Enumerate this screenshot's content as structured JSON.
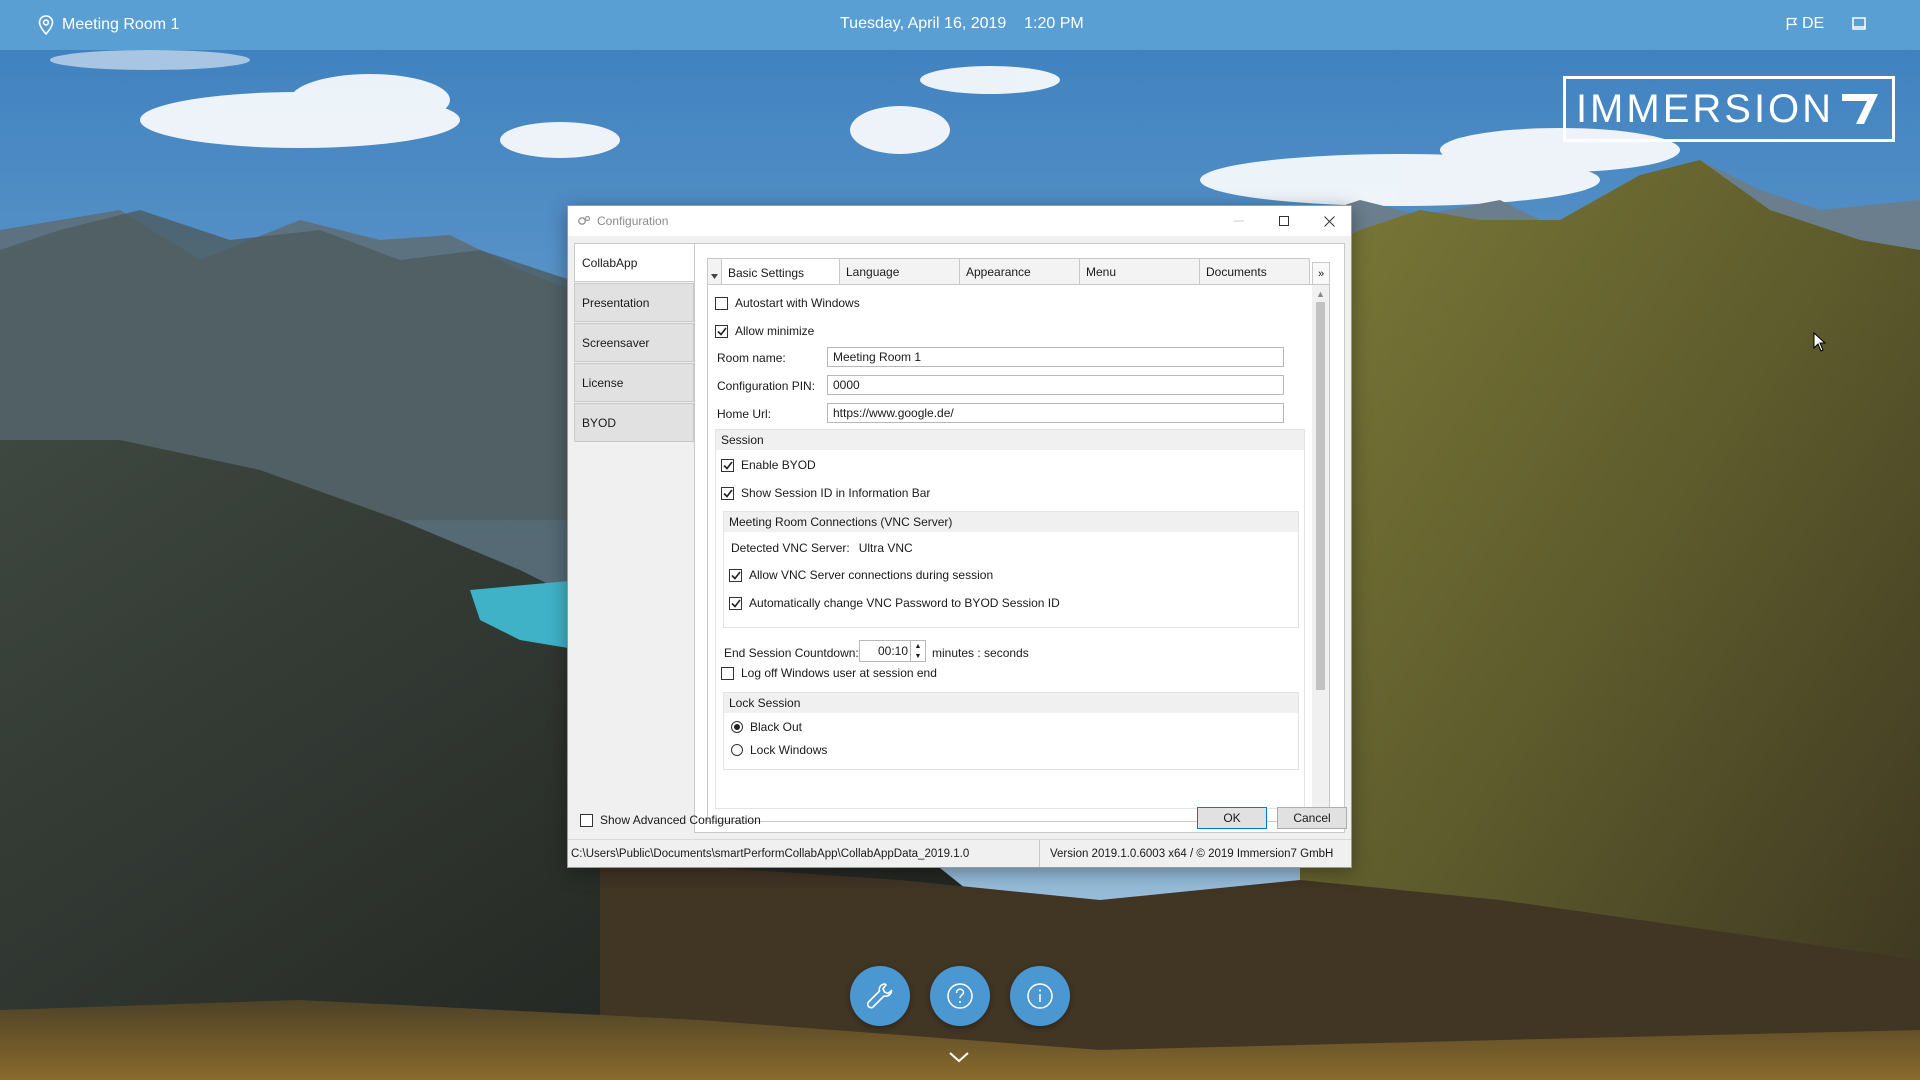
{
  "topbar": {
    "room": "Meeting Room 1",
    "date": "Tuesday, April 16, 2019",
    "time": "1:20 PM",
    "language": "DE",
    "location_icon": "location-pin-icon",
    "flag_icon": "flag-icon",
    "screen_icon": "screen-icon"
  },
  "logo": {
    "text": "IMMERSION",
    "mark": "7"
  },
  "dialog": {
    "title": "Configuration",
    "side_tabs": [
      {
        "label": "CollabApp",
        "active": true
      },
      {
        "label": "Presentation",
        "active": false
      },
      {
        "label": "Screensaver",
        "active": false
      },
      {
        "label": "License",
        "active": false
      },
      {
        "label": "BYOD",
        "active": false
      }
    ],
    "tabs": [
      {
        "label": "Basic Settings",
        "active": true
      },
      {
        "label": "Language",
        "active": false
      },
      {
        "label": "Appearance",
        "active": false
      },
      {
        "label": "Menu",
        "active": false
      },
      {
        "label": "Documents",
        "active": false
      }
    ],
    "tab_more": "»",
    "basic": {
      "autostart": {
        "label": "Autostart with Windows",
        "checked": false
      },
      "allow_minimize": {
        "label": "Allow minimize",
        "checked": true
      },
      "room_name": {
        "label": "Room name:",
        "value": "Meeting Room 1"
      },
      "config_pin": {
        "label": "Configuration PIN:",
        "value": "0000"
      },
      "home_url": {
        "label": "Home Url:",
        "value": "https://www.google.de/"
      },
      "session": {
        "header": "Session",
        "enable_byod": {
          "label": "Enable BYOD",
          "checked": true
        },
        "show_session_id": {
          "label": "Show Session ID in Information Bar",
          "checked": true
        },
        "vnc": {
          "header": "Meeting Room Connections (VNC Server)",
          "detected_label": "Detected VNC Server:",
          "detected_value": "Ultra VNC",
          "allow_connections": {
            "label": "Allow VNC Server connections during session",
            "checked": true
          },
          "auto_change_pw": {
            "label": "Automatically change VNC Password to BYOD Session ID",
            "checked": true
          }
        },
        "countdown": {
          "label": "End Session Countdown:",
          "value": "00:10",
          "unit": "minutes : seconds"
        },
        "log_off": {
          "label": "Log off Windows user at session end",
          "checked": false
        },
        "lock": {
          "header": "Lock Session",
          "options": [
            {
              "label": "Black Out",
              "selected": true
            },
            {
              "label": "Lock Windows",
              "selected": false
            }
          ]
        }
      }
    },
    "show_advanced": {
      "label": "Show Advanced Configuration",
      "checked": false
    },
    "ok_label": "OK",
    "cancel_label": "Cancel",
    "status_path": "C:\\Users\\Public\\Documents\\smartPerformCollabApp\\CollabAppData_2019.1.0",
    "status_version": "Version 2019.1.0.6003 x64 / © 2019 Immersion7 GmbH"
  },
  "fabs": [
    {
      "icon": "wrench-icon"
    },
    {
      "icon": "help-icon"
    },
    {
      "icon": "info-icon"
    }
  ],
  "colors": {
    "accent": "#5a9fd4",
    "fab": "#4a97d2"
  }
}
